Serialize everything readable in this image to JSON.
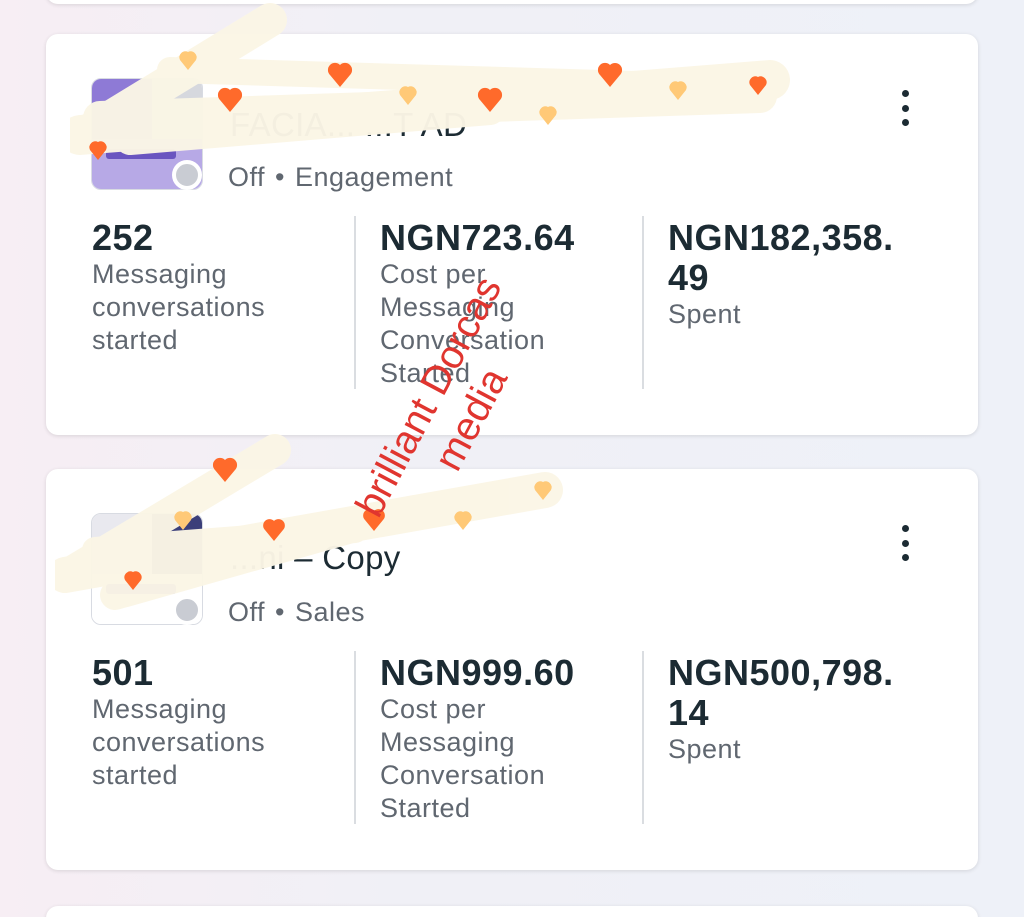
{
  "ads": [
    {
      "title": "FACIA... ...T AD",
      "status": "Off",
      "objective": "Engagement",
      "metrics": [
        {
          "value": "252",
          "label": "Messaging conversations started"
        },
        {
          "value": "NGN723.64",
          "label": "Cost per Messaging Conversation Started"
        },
        {
          "value": "NGN182,358.49",
          "value_line1": "NGN182,358.",
          "value_line2": "49",
          "label": "Spent"
        }
      ]
    },
    {
      "title": "...ni – Copy",
      "status": "Off",
      "objective": "Sales",
      "metrics": [
        {
          "value": "501",
          "label": "Messaging conversations started"
        },
        {
          "value": "NGN999.60",
          "label": "Cost per Messaging Conversation Started"
        },
        {
          "value": "NGN500,798.14",
          "value_line1": "NGN500,798.",
          "value_line2": "14",
          "label": "Spent"
        }
      ]
    }
  ],
  "labels": {
    "messaging_1": "Messaging",
    "messaging_2": "conversations",
    "messaging_3": "started",
    "cost_1": "Cost per",
    "cost_2": "Messaging",
    "cost_3": "Conversation",
    "cost_4": "Started",
    "spent": "Spent",
    "dot": "•"
  },
  "watermark": {
    "line1": "brilliant Dorcas",
    "line2": "media"
  },
  "icons": [
    "more-vertical-icon",
    "status-dot-icon"
  ],
  "colors": {
    "card_bg": "#ffffff",
    "text_primary": "#1c2b33",
    "text_secondary": "#606770",
    "status_off": "#c9ccd3",
    "watermark": "#e0352f",
    "scribble_hearts": "#ff6a2b"
  }
}
